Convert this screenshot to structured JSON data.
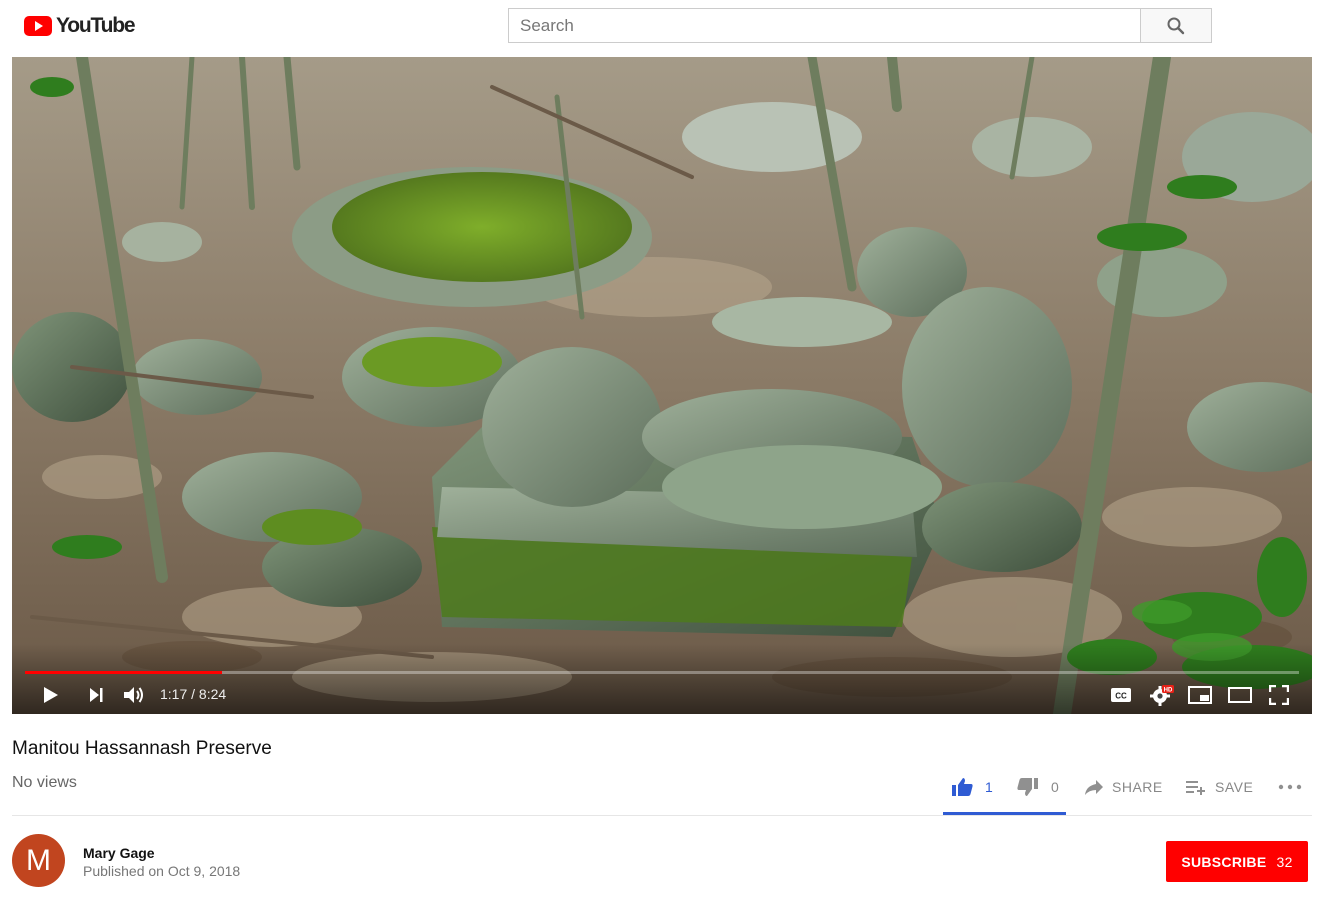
{
  "header": {
    "logo_text": "YouTube",
    "search_placeholder": "Search"
  },
  "player": {
    "current_time": "1:17",
    "duration": "8:24",
    "time_display": "1:17 / 8:24",
    "progress_fraction": 0.155,
    "hd_badge": "HD"
  },
  "video": {
    "title": "Manitou Hassannash Preserve",
    "views": "No views",
    "likes": "1",
    "dislikes": "0",
    "share_label": "SHARE",
    "save_label": "SAVE",
    "like_ratio": 1.0
  },
  "channel": {
    "avatar_letter": "M",
    "name": "Mary Gage",
    "published": "Published on Oct 9, 2018",
    "subscribe_label": "SUBSCRIBE",
    "subscriber_count": "32"
  },
  "colors": {
    "brand_red": "#ff0000",
    "like_blue": "#2f5bd3",
    "avatar_bg": "#c1451f"
  }
}
